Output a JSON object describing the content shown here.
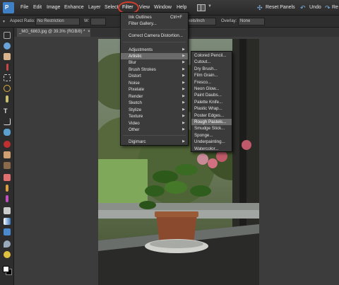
{
  "menubar": {
    "logo_letter": "P",
    "items": [
      "File",
      "Edit",
      "Image",
      "Enhance",
      "Layer",
      "Select",
      "Filter",
      "View",
      "Window",
      "Help"
    ],
    "reset_panels": "Reset Panels",
    "undo": "Undo",
    "redo": "Re"
  },
  "options": {
    "aspect_ratio_label": "Aspect Ratio:",
    "aspect_ratio_value": "No Restriction",
    "w_label": "W:",
    "res_value": "ixels/inch",
    "overlay_label": "Overlay:",
    "overlay_value": "None"
  },
  "document": {
    "tab_title": "_MG_6863.jpg @ 39.3% (RGB/8) *",
    "tab_close": "×"
  },
  "filter_menu": {
    "last_filter": "Ink Outlines",
    "last_filter_shortcut": "Ctrl+F",
    "filter_gallery": "Filter Gallery...",
    "camera_distortion": "Correct Camera Distortion...",
    "submenus": [
      "Adjustments",
      "Artistic",
      "Blur",
      "Brush Strokes",
      "Distort",
      "Noise",
      "Pixelate",
      "Render",
      "Sketch",
      "Stylize",
      "Texture",
      "Video",
      "Other"
    ],
    "digimarc": "Digimarc",
    "active": "Artistic"
  },
  "artistic_menu": {
    "items": [
      "Colored Pencil...",
      "Cutout...",
      "Dry Brush...",
      "Film Grain...",
      "Fresco...",
      "Neon Glow...",
      "Paint Daubs...",
      "Palette Knife...",
      "Plastic Wrap...",
      "Poster Edges...",
      "Rough Pastels...",
      "Smudge Stick...",
      "Sponge...",
      "Underpainting...",
      "Watercolor..."
    ],
    "active": "Rough Pastels..."
  },
  "colors": {
    "highlight_circle": "#d23d2d",
    "menu_bg": "#3b3b3b",
    "menu_active": "#6a6a6a",
    "accent_blue": "#7fb3e8"
  },
  "icons": [
    "app-logo-icon",
    "layout-icon",
    "reset-panels-icon",
    "undo-icon",
    "redo-icon",
    "submenu-arrow-icon",
    "move-tool-icon",
    "zoom-tool-icon",
    "hand-tool-icon",
    "eyedropper-tool-icon",
    "marquee-tool-icon",
    "lasso-tool-icon",
    "magic-wand-tool-icon",
    "type-tool-icon",
    "crop-tool-icon",
    "cookie-cutter-tool-icon",
    "red-eye-tool-icon",
    "spot-healing-tool-icon",
    "clone-stamp-tool-icon",
    "eraser-tool-icon",
    "brush-tool-icon",
    "smart-brush-tool-icon",
    "paint-bucket-tool-icon",
    "gradient-tool-icon",
    "shape-tool-icon",
    "blur-tool-icon",
    "sponge-tool-icon",
    "color-swatches-icon"
  ]
}
